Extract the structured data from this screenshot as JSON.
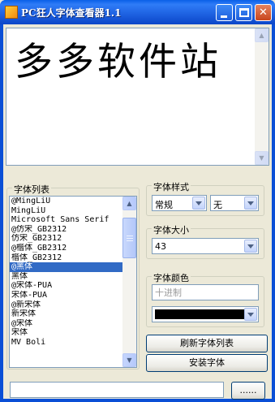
{
  "window": {
    "title": "PC狂人字体查看器1.1"
  },
  "preview": {
    "text": "多多软件站"
  },
  "font_list": {
    "label": "字体列表",
    "selected_index": 7,
    "items": [
      "@MingLiU",
      "MingLiU",
      "Microsoft Sans Serif",
      "@仿宋_GB2312",
      "仿宋_GB2312",
      "@楷体_GB2312",
      "楷体_GB2312",
      "@黑体",
      "黑体",
      "@宋体-PUA",
      "宋体-PUA",
      "@新宋体",
      "新宋体",
      "@宋体",
      "宋体",
      "MV Boli"
    ]
  },
  "font_style": {
    "label": "字体样式",
    "style_value": "常规",
    "decoration_value": "无"
  },
  "font_size": {
    "label": "字体大小",
    "value": "43"
  },
  "font_color": {
    "label": "字体颜色",
    "hex_placeholder": "十进制",
    "swatch": "#000000"
  },
  "buttons": {
    "refresh": "刷新字体列表",
    "install": "安装字体",
    "browse": "......"
  },
  "status": {
    "text": ""
  }
}
